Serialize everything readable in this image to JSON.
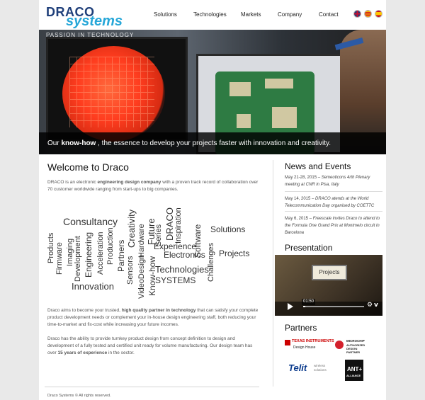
{
  "logo": {
    "line1": "DRACO",
    "line2": "systems"
  },
  "nav": [
    {
      "label": "Solutions"
    },
    {
      "label": "Technologies"
    },
    {
      "label": "Markets"
    },
    {
      "label": "Company"
    },
    {
      "label": "Contact"
    }
  ],
  "hero": {
    "tagline": "PASSION IN TECHNOLOGY",
    "caption_pre": "Our ",
    "caption_bold": "know-how",
    "caption_post": " , the essence to develop your projects faster with innovation and creativity.",
    "screen_label": "Projects"
  },
  "welcome": {
    "title": "Welcome to Draco",
    "intro_pre": "DRACO is an electronic ",
    "intro_bold": "engineering design company",
    "intro_post": " with a proven track record of collaboration over 70 customer worldwide ranging from start-ups to big companies.",
    "para2_pre": "Draco aims to become your trusted, ",
    "para2_bold": "high quality partner in technology",
    "para2_post": " that can satisfy your complete product development needs or complement your in-house design engineering staff, both reducing your time-to-market and fix-cost while increasing your future incomes.",
    "para3_pre": "Draco has the ability to provide turnkey product design from concept definition to design and development of a fully tested and certified unit ready for volume manufacturing. Our design team has over ",
    "para3_bold": "15 years of experience",
    "para3_post": " in the sector."
  },
  "word_cloud": [
    "Consultancy",
    "Products",
    "Firmware",
    "Imaging",
    "Development",
    "Engineering",
    "Acceleration",
    "Production",
    "Innovation",
    "Partners",
    "Sensors",
    "Creativity",
    "Hardware",
    "Future",
    "VideoDesign",
    "Know-how",
    "Series",
    "DRACO",
    "Inspiration",
    "Experience",
    "Electronics",
    "Technologies",
    "SYSTEMS",
    "Software",
    "Solutions",
    "Challenges",
    "Projects"
  ],
  "news": {
    "title": "News and Events",
    "items": [
      {
        "date": "May 21-28, 2015 – ",
        "text": "Semeoticons 4rth Plenary meeting at CNR in Pisa, Italy"
      },
      {
        "date": "May 14, 2015 – ",
        "text": "DRACO atends at the World Telecommunication Day organised by COETTC"
      },
      {
        "date": "May 6, 2015 – ",
        "text": "Freescale invites Draco to attend to the Formula One Grand Prix at Montmelo circuit in Barcelona"
      }
    ]
  },
  "presentation": {
    "title": "Presentation",
    "time": "01:50",
    "settings_icon": "gear-icon",
    "vimeo_label": "v"
  },
  "partners": {
    "title": "Partners",
    "ti_name": "TEXAS INSTRUMENTS",
    "ti_sub": "Design House",
    "mc_name": "MICROCHIP",
    "mc_sub": "AUTHORIZED DESIGN PARTNER",
    "telit_name": "Telit",
    "telit_sub": "wireless solutions",
    "ant_name": "ANT+",
    "ant_sub": "ALLIANCE"
  },
  "footer": {
    "text": "Draco Systems © All rights reserved."
  },
  "colors": {
    "brand_dark": "#1f3f7a",
    "brand_light": "#27a7d8",
    "caption_bg": "#000000"
  }
}
